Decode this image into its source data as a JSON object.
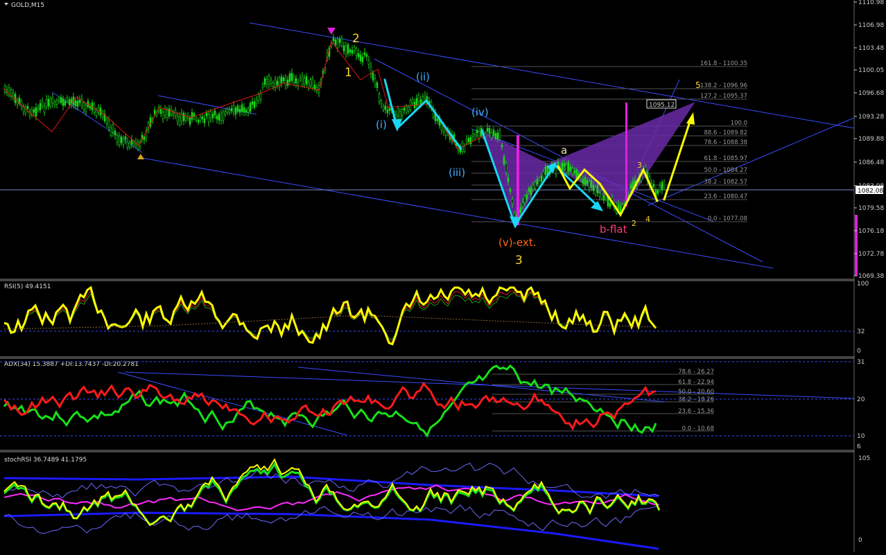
{
  "window": {
    "title": "GOLD,M15"
  },
  "colors": {
    "background": "#000000",
    "grid": "#2a2a50",
    "channel": "#3b4cff",
    "candle": "#18d418",
    "wave_cyan": "#19d6f2",
    "wave_yellow": "#ffff00",
    "pattern_fill": "#7a2fb8",
    "magenta": "#e020e0",
    "orange": "#ff6a1a",
    "pink": "#ff3d7a",
    "adx_green": "#18e018",
    "adx_red": "#ff1a1a",
    "stoch_magenta": "#ff2bff",
    "stoch_blue": "#1a1aff"
  },
  "price_axis": {
    "ticks": [
      "1110.98",
      "1106.98",
      "1103.48",
      "1100.05",
      "1096.68",
      "1093.28",
      "1089.88",
      "1086.48",
      "1083.08",
      "1079.58",
      "1076.18",
      "1072.78",
      "1069.38"
    ],
    "current_price": "1082.08",
    "marker_price": "1095.12"
  },
  "wave_labels": {
    "top2": "2",
    "top1": "1",
    "i": "(i)",
    "ii": "(ii)",
    "iii": "(iii)",
    "iv": "(iv)",
    "v_ext": "(v)-ext.",
    "three": "3",
    "a": "a",
    "b_flat": "b-flat",
    "small2": "2",
    "small3": "3",
    "small4": "4",
    "five": "5"
  },
  "fib_levels": [
    "161.8 - 1100.35",
    "138.2 - 1096.96",
    "127.2 - 1095.37",
    "100.0",
    "88.6 - 1089.82",
    "78.6 - 1088.38",
    "61.8 - 1085.97",
    "50.0 - 1084.27",
    "38.2 - 1082.57",
    "23.6 - 1080.47",
    "0.0 - 1077.08"
  ],
  "rsi": {
    "title": "RSI(5) 49.4151",
    "ticks": [
      "100",
      "32",
      "0"
    ]
  },
  "adx": {
    "title": "ADX(34) 15.3887 +DI:13.7437 -DI:20.2781",
    "ticks": [
      "31",
      "20",
      "10",
      "6"
    ],
    "fib_levels": [
      "78.6 - 26.27",
      "61.8 - 22.94",
      "50.0 - 20.60",
      "38.2 - 18.26",
      "23.6 - 15.36",
      "0.0 - 10.68"
    ]
  },
  "stochrsi": {
    "title": "stochRSI 36.7489 41.1795",
    "ticks": [
      "105",
      "0"
    ]
  }
}
